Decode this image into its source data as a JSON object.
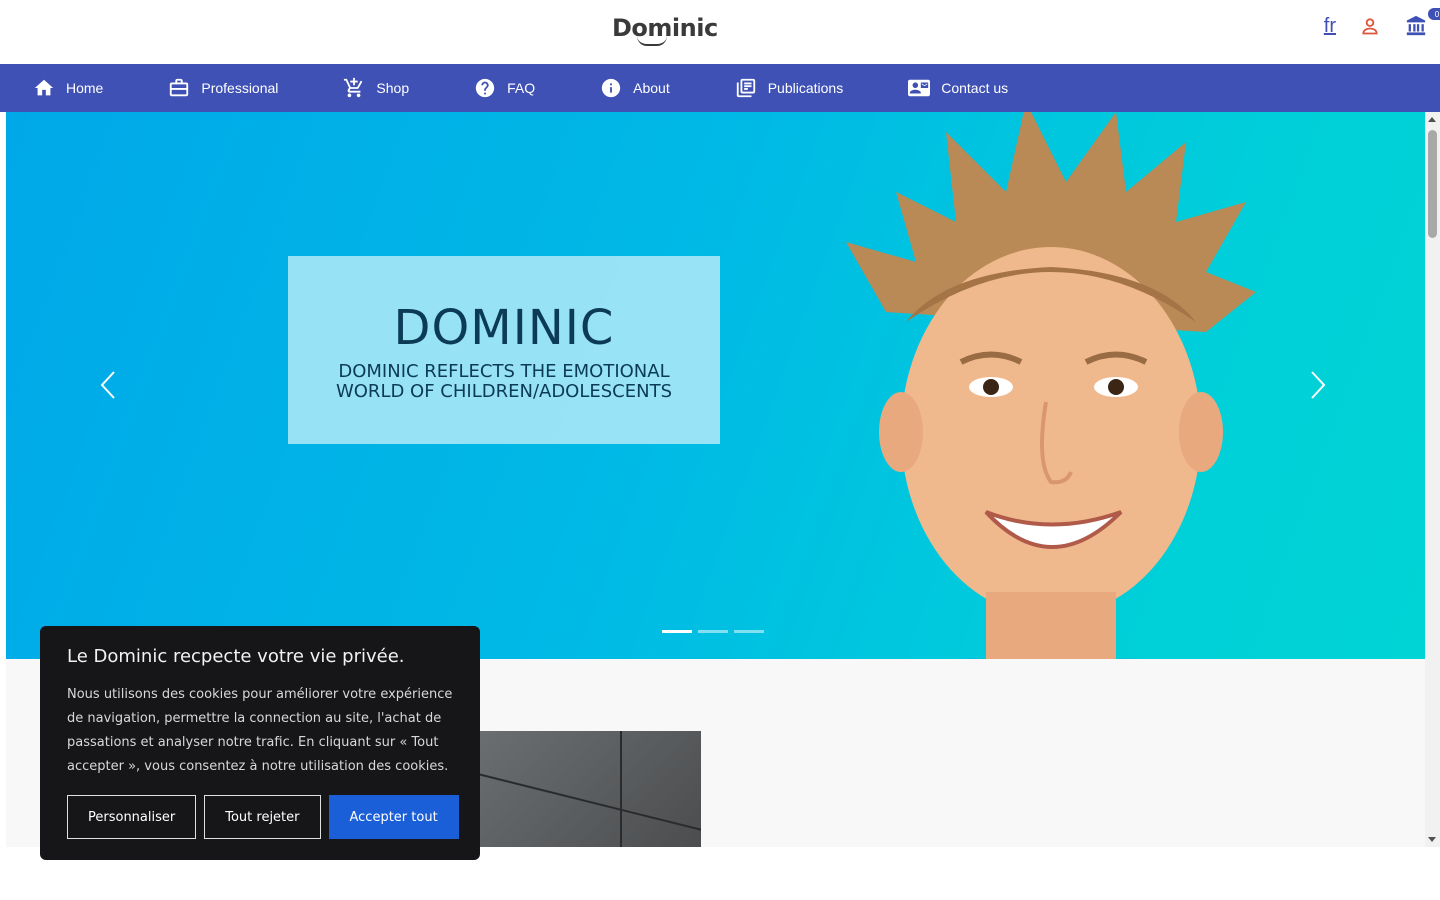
{
  "header": {
    "logo": "Dominic",
    "lang": "fr",
    "cart_count": "0"
  },
  "nav": {
    "items": [
      {
        "label": "Home",
        "icon": "home-icon"
      },
      {
        "label": "Professional",
        "icon": "briefcase-icon"
      },
      {
        "label": "Shop",
        "icon": "cart-add-icon"
      },
      {
        "label": "FAQ",
        "icon": "help-circle-icon"
      },
      {
        "label": "About",
        "icon": "info-circle-icon"
      },
      {
        "label": "Publications",
        "icon": "library-books-icon"
      },
      {
        "label": "Contact us",
        "icon": "contact-mail-icon"
      }
    ]
  },
  "hero": {
    "title": "DOMINIC",
    "subtitle": "DOMINIC REFLECTS THE EMOTIONAL WORLD OF CHILDREN/ADOLESCENTS",
    "slide_count": 3,
    "active_slide": 1
  },
  "cookie": {
    "title": "Le Dominic recpecte votre vie privée.",
    "text": "Nous utilisons des cookies pour améliorer votre expérience de navigation, permettre la connection au site, l'achat de passations et analyser notre trafic. En cliquant sur « Tout accepter », vous consentez à notre utilisation des cookies.",
    "btn_customize": "Personnaliser",
    "btn_reject": "Tout rejeter",
    "btn_accept": "Accepter tout"
  },
  "colors": {
    "nav_bg": "#3f51b5",
    "accept_btn": "#1a5fd8",
    "cookie_bg": "#161618",
    "user_icon": "#e0533d"
  }
}
